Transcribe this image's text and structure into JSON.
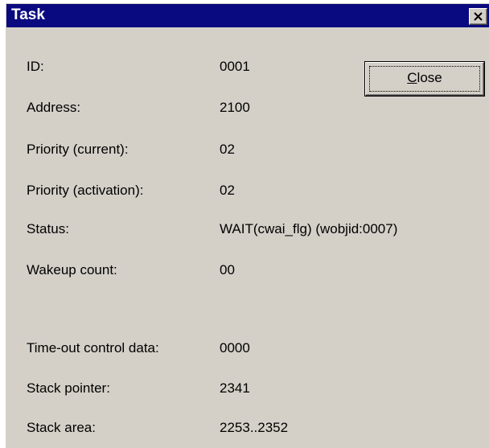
{
  "window": {
    "title": "Task"
  },
  "close_button": {
    "mnemonic": "C",
    "rest": "lose"
  },
  "fields": [
    {
      "label": "ID:",
      "value": "0001"
    },
    {
      "label": "Address:",
      "value": "2100"
    },
    {
      "label": "Priority (current):",
      "value": "02"
    },
    {
      "label": "Priority (activation):",
      "value": "02"
    },
    {
      "label": "Status:",
      "value": "WAIT(cwai_flg) (wobjid:0007)"
    },
    {
      "label": "Wakeup count:",
      "value": "00"
    },
    {
      "label": "Time-out control data:",
      "value": "0000"
    },
    {
      "label": "Stack pointer:",
      "value": "2341"
    },
    {
      "label": "Stack area:",
      "value": "2253..2352"
    }
  ],
  "colors": {
    "titlebar": "#0a0a80",
    "dialog_face": "#d4d0c8"
  },
  "icons": {
    "titlebar_close": "close-x-icon"
  }
}
